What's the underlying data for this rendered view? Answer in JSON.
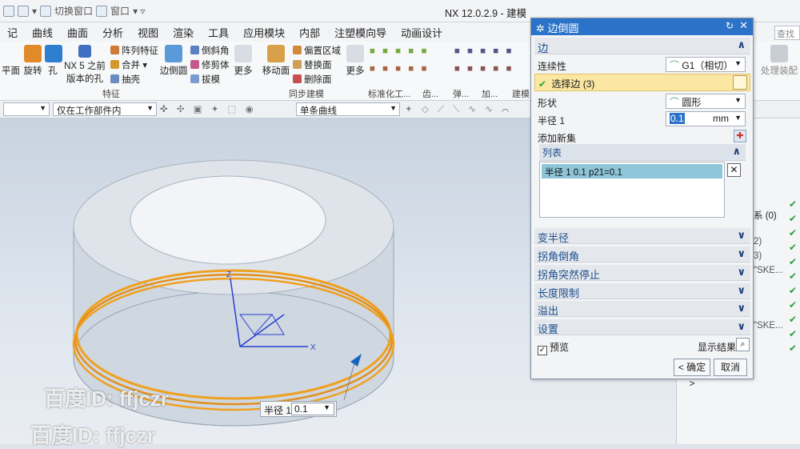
{
  "window": {
    "title": "NX 12.0.2.9 - 建模",
    "quick_switch": "切换窗口",
    "quick_window": "窗口"
  },
  "menu": [
    "记",
    "曲线",
    "曲面",
    "分析",
    "视图",
    "渲染",
    "工具",
    "应用模块",
    "内部",
    "注塑模向导",
    "动画设计"
  ],
  "search": {
    "placeholder": "查找"
  },
  "ribbon": {
    "plane": "平面",
    "rotate": "旋转",
    "hole": "孔",
    "nx5_hole": "NX 5 之前",
    "nx5_hole2": "版本的孔",
    "array": "阵列特征",
    "merge": "合并",
    "shell": "抽壳",
    "edge_blend": "边倒圆",
    "chamfer": "倒斜角",
    "trim": "修剪体",
    "draft": "拔模",
    "more1": "更多",
    "move_face": "移动面",
    "offset_region": "偏置区域",
    "replace_face": "替换面",
    "delete_face": "删除面",
    "more2": "更多",
    "group_feature": "特征",
    "group_sync": "同步建模",
    "group_standard": "标准化工...",
    "group_gear": "齿...",
    "group_spring": "弹...",
    "group_add": "加...",
    "group_build": "建模",
    "process_assembly": "处理装配"
  },
  "toolbar2": {
    "filter_empty": "",
    "scope": "仅在工作部件内",
    "curve_rule": "单条曲线"
  },
  "dialog": {
    "title": "边倒圆",
    "section_edge": "边",
    "continuity_label": "连续性",
    "continuity_value": "G1（相切）",
    "select_edge": "选择边 (3)",
    "shape_label": "形状",
    "shape_value": "圆形",
    "radius_label": "半径 1",
    "radius_value": "0.1",
    "radius_unit": "mm",
    "add_set": "添加新集",
    "list_header": "列表",
    "list_items": [
      "半径 1  0.1  p21=0.1"
    ],
    "sections_collapsed": [
      "变半径",
      "拐角倒角",
      "拐角突然停止",
      "长度限制",
      "溢出",
      "设置"
    ],
    "preview_label": "预览",
    "show_result": "显示结果",
    "ok": "< 确定 >",
    "cancel": "取消"
  },
  "viewport": {
    "radius_tag_label": "半径 1",
    "radius_tag_value": "0.1",
    "axis_x": "X",
    "axis_z": "Z"
  },
  "right_panel": {
    "rows": [
      "系 (0)",
      "2)",
      "3)",
      "\"SKE...",
      "\"SKE..."
    ]
  },
  "watermarks": [
    "百度ID: ffjczr",
    "百度ID: ffjczr"
  ],
  "colors": {
    "dialog_title": "#2b73c8",
    "selection_highlight": "#fbe6a2",
    "edge_highlight": "#f0a020",
    "list_selected": "#8ec5d9"
  }
}
